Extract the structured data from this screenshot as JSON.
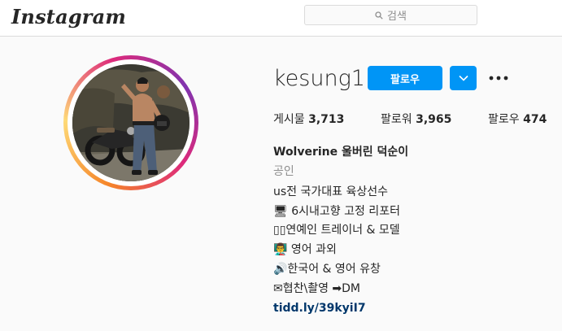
{
  "header": {
    "logo": "Instagram",
    "search_placeholder": "검색"
  },
  "profile": {
    "username": "kesung1",
    "follow_label": "팔로우",
    "stats": [
      {
        "label": "게시물",
        "value": "3,713"
      },
      {
        "label": "팔로워",
        "value": "3,965"
      },
      {
        "label": "팔로우",
        "value": "474"
      }
    ],
    "full_name": "Wolverine 울버린 덕순이",
    "category": "공인",
    "bio_lines": [
      "us전 국가대표 육상선수",
      "🖥 6시내고향 고정 리포터",
      "▯▯연예인 트레이너 & 모델",
      "👨‍🏫 영어 과외",
      "🔊한국어 & 영어 유창",
      "✉협찬\\촬영 ➡DM"
    ],
    "link": "tidd.ly/39kyiI7"
  },
  "colors": {
    "accent": "#0095f6",
    "link": "#00376b",
    "muted": "#8e8e8e"
  },
  "icons": [
    "search-icon",
    "chevron-down-icon",
    "more-options-icon"
  ]
}
